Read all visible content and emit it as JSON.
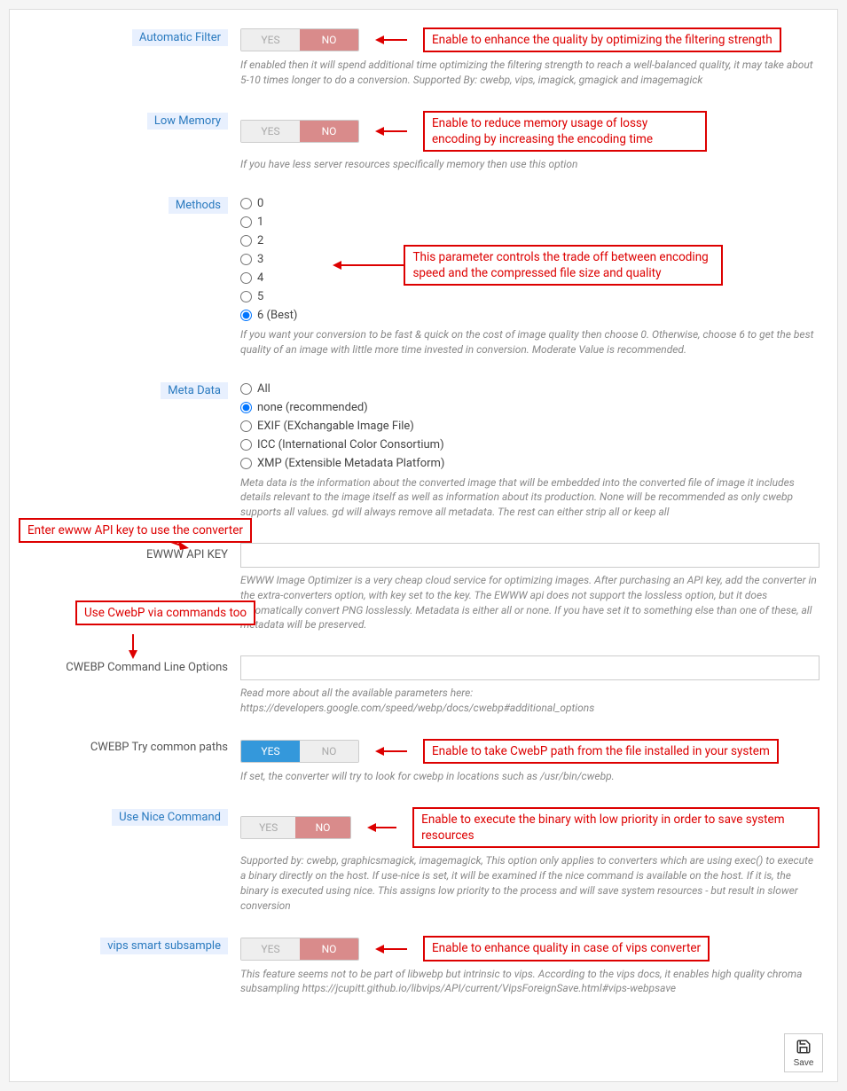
{
  "toggles": {
    "yes": "YES",
    "no": "NO"
  },
  "automaticFilter": {
    "label": "Automatic Filter",
    "value": "no",
    "desc": "If enabled then it will spend additional time optimizing the filtering strength to reach a well-balanced quality, it may take about 5-10 times longer to do a conversion. Supported By: cwebp, vips, imagick, gmagick and imagemagick",
    "callout": "Enable to enhance the quality by optimizing the filtering strength"
  },
  "lowMemory": {
    "label": "Low Memory",
    "value": "no",
    "desc": "If you have less server resources specifically memory then use this option",
    "callout": "Enable to reduce memory usage of lossy encoding by increasing the encoding time"
  },
  "methods": {
    "label": "Methods",
    "options": [
      {
        "label": "0",
        "selected": false
      },
      {
        "label": "1",
        "selected": false
      },
      {
        "label": "2",
        "selected": false
      },
      {
        "label": "3",
        "selected": false
      },
      {
        "label": "4",
        "selected": false
      },
      {
        "label": "5",
        "selected": false
      },
      {
        "label": "6 (Best)",
        "selected": true
      }
    ],
    "desc": "If you want your conversion to be fast & quick on the cost of image quality then choose 0. Otherwise, choose 6 to get the best quality of an image with little more time invested in conversion. Moderate Value is recommended.",
    "callout": "This parameter controls the trade off between encoding speed and the compressed file size and quality"
  },
  "metaData": {
    "label": "Meta Data",
    "options": [
      {
        "label": "All",
        "selected": false
      },
      {
        "label": "none (recommended)",
        "selected": true
      },
      {
        "label": "EXIF (EXchangable Image File)",
        "selected": false
      },
      {
        "label": "ICC (International Color Consortium)",
        "selected": false
      },
      {
        "label": "XMP (Extensible Metadata Platform)",
        "selected": false
      }
    ],
    "desc": "Meta data is the information about the converted image that will be embedded into the converted file of image it includes details relevant to the image itself as well as information about its production. None will be recommended as only cwebp supports all values. gd will always remove all metadata. The rest can either strip all or keep all"
  },
  "ewwwKey": {
    "label": "EWWW API KEY",
    "value": "",
    "desc": "EWWW Image Optimizer is a very cheap cloud service for optimizing images. After purchasing an API key, add the converter in the extra-converters option, with key set to the key. The EWWW api does not support the lossless option, but it does automatically convert PNG losslessly. Metadata is either all or none. If you have set it to something else than one of these, all metadata will be preserved.",
    "callout": "Enter ewww API key to use the converter"
  },
  "cwebpCmd": {
    "label": "CWEBP Command Line Options",
    "value": "",
    "desc": "Read more about all the available parameters here: https://developers.google.com/speed/webp/docs/cwebp#additional_options",
    "callout": "Use CwebP via commands too"
  },
  "cwebpTry": {
    "label": "CWEBP Try common paths",
    "value": "yes",
    "desc": "If set, the converter will try to look for cwebp in locations such as /usr/bin/cwebp.",
    "callout": "Enable to take CwebP path from the file installed in your system"
  },
  "useNice": {
    "label": "Use Nice Command",
    "value": "no",
    "desc": "Supported by: cwebp, graphicsmagick, imagemagick, This option only applies to converters which are using exec() to execute a binary directly on the host. If use-nice is set, it will be examined if the nice command is available on the host. If it is, the binary is executed using nice. This assigns low priority to the process and will save system resources - but result in slower conversion",
    "callout": "Enable to execute the binary with low priority in order to save system resources"
  },
  "vipsSmart": {
    "label": "vips smart subsample",
    "value": "no",
    "desc": "This feature seems not to be part of libwebp but intrinsic to vips. According to the vips docs, it enables high quality chroma subsampling https://jcupitt.github.io/libvips/API/current/VipsForeignSave.html#vips-webpsave",
    "callout": "Enable to enhance quality in case of vips converter"
  },
  "save": {
    "label": "Save"
  }
}
